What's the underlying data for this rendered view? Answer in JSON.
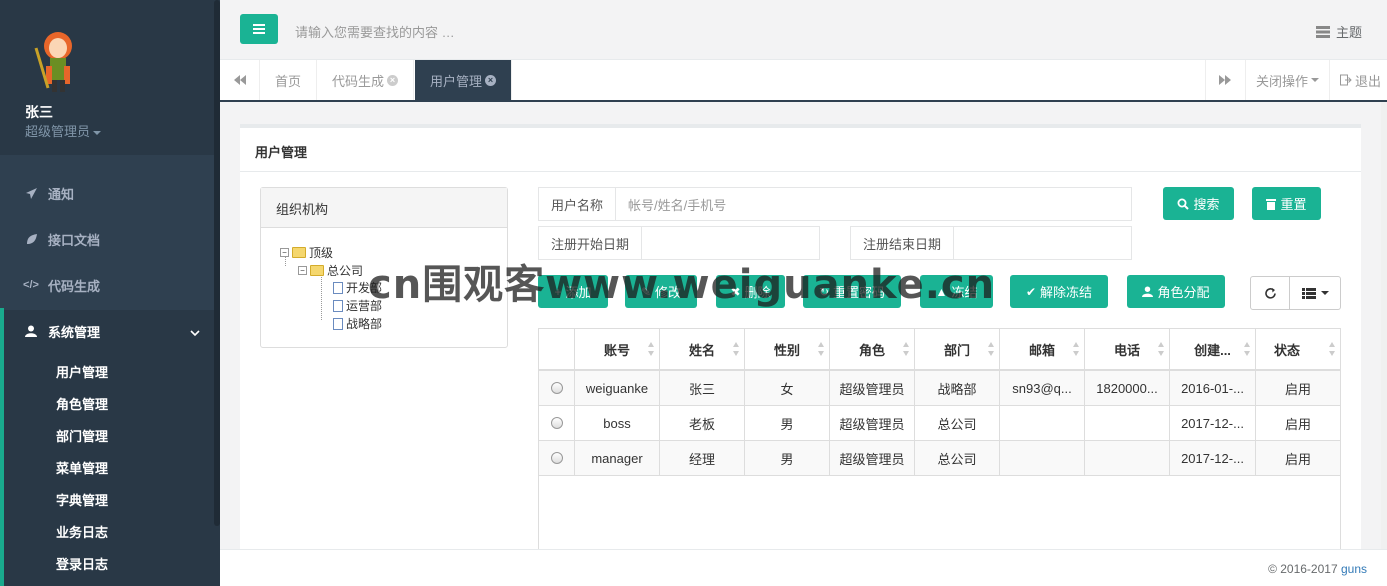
{
  "sidebar": {
    "user_name": "张三",
    "user_role": "超级管理员",
    "nav": [
      {
        "label": "通知",
        "icon": "paper-plane-icon"
      },
      {
        "label": "接口文档",
        "icon": "leaf-icon"
      },
      {
        "label": "代码生成",
        "icon": "code-icon"
      },
      {
        "label": "系统管理",
        "icon": "user-icon"
      }
    ],
    "sub_items": [
      "用户管理",
      "角色管理",
      "部门管理",
      "菜单管理",
      "字典管理",
      "业务日志",
      "登录日志"
    ]
  },
  "topbar": {
    "search_placeholder": "请输入您需要查找的内容 …",
    "theme_label": "主题"
  },
  "tabs": {
    "items": [
      "首页",
      "代码生成",
      "用户管理"
    ],
    "close_ops": "关闭操作",
    "logout": "退出"
  },
  "panel": {
    "title": "用户管理",
    "org_title": "组织机构",
    "tree": {
      "root": "顶级",
      "company": "总公司",
      "depts": [
        "开发部",
        "运营部",
        "战略部"
      ]
    }
  },
  "filters": {
    "username_label": "用户名称",
    "username_placeholder": "帐号/姓名/手机号",
    "start_label": "注册开始日期",
    "end_label": "注册结束日期"
  },
  "buttons": {
    "search": "搜索",
    "reset": "重置",
    "add": "添加",
    "edit": "修改",
    "delete": "删除",
    "reset_pwd": "重置密码",
    "freeze": "冻结",
    "unfreeze": "解除冻结",
    "assign_role": "角色分配"
  },
  "table": {
    "headers": [
      "账号",
      "姓名",
      "性别",
      "角色",
      "部门",
      "邮箱",
      "电话",
      "创建...",
      "状态"
    ],
    "rows": [
      [
        "weiguanke",
        "张三",
        "女",
        "超级管理员",
        "战略部",
        "sn93@q...",
        "1820000...",
        "2016-01-...",
        "启用"
      ],
      [
        "boss",
        "老板",
        "男",
        "超级管理员",
        "总公司",
        "",
        "",
        "2017-12-...",
        "启用"
      ],
      [
        "manager",
        "经理",
        "男",
        "超级管理员",
        "总公司",
        "",
        "",
        "2017-12-...",
        "启用"
      ]
    ]
  },
  "footer": {
    "copyright": "© 2016-2017",
    "brand": "guns"
  },
  "watermark": "cn围观客www.weiguanke.cn",
  "colors": {
    "accent": "#1ab394",
    "sidebar_bg": "#2f4050"
  }
}
